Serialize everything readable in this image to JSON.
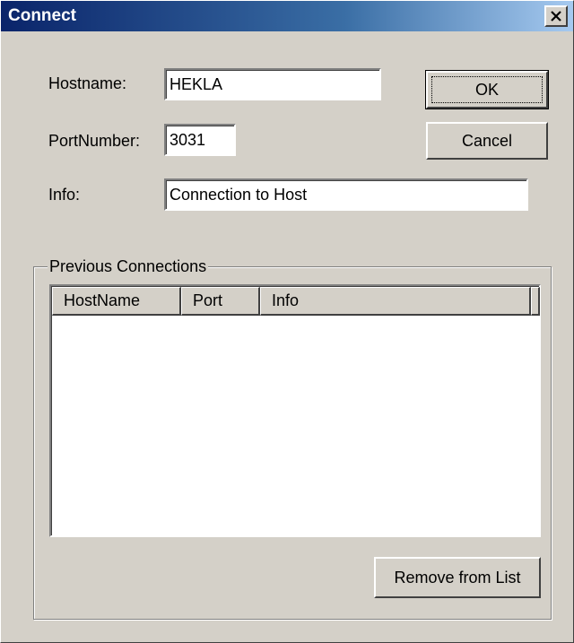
{
  "window": {
    "title": "Connect"
  },
  "form": {
    "hostname": {
      "label": "Hostname:",
      "value": "HEKLA"
    },
    "port": {
      "label": "PortNumber:",
      "value": "3031"
    },
    "info": {
      "label": "Info:",
      "value": "Connection to Host"
    }
  },
  "buttons": {
    "ok": "OK",
    "cancel": "Cancel",
    "remove": "Remove from List"
  },
  "previous": {
    "title": "Previous Connections",
    "columns": [
      "HostName",
      "Port",
      "Info"
    ],
    "rows": []
  },
  "icons": {
    "close": "close-icon"
  },
  "colors": {
    "face": "#d4d0c8",
    "title_start": "#0a246a",
    "title_end": "#a6caf0"
  }
}
